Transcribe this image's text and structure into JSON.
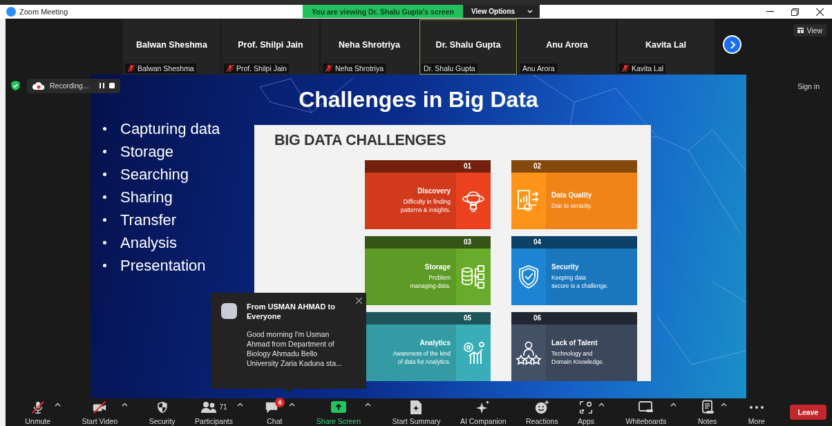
{
  "window": {
    "title": "Zoom Meeting"
  },
  "share_banner": {
    "text": "You are viewing Dr. Shalu Gupta's screen",
    "button": "View Options"
  },
  "participants": [
    {
      "name": "Balwan Sheshma",
      "label": "Balwan Sheshma",
      "muted": true,
      "selected": false
    },
    {
      "name": "Prof. Shilpi Jain",
      "label": "Prof. Shilpi Jain",
      "muted": true,
      "selected": false
    },
    {
      "name": "Neha Shrotriya",
      "label": "Neha Shrotriya",
      "muted": true,
      "selected": false
    },
    {
      "name": "Dr. Shalu Gupta",
      "label": "Dr. Shalu Gupta",
      "muted": false,
      "selected": true
    },
    {
      "name": "Anu Arora",
      "label": "Anu Arora",
      "muted": false,
      "selected": false
    },
    {
      "name": "Kavita Lal",
      "label": "Kavita Lal",
      "muted": true,
      "selected": false
    }
  ],
  "view_button": "View",
  "recording": {
    "label": "Recording..."
  },
  "sign_in": "Sign in",
  "slide": {
    "title": "Challenges in Big Data",
    "bullets": [
      "Capturing data",
      "Storage",
      "Searching",
      "Sharing",
      "Transfer",
      "Analysis",
      "Presentation"
    ],
    "panel": {
      "title": "BIG DATA CHALLENGES",
      "cards": [
        {
          "number": "01",
          "title": "Discovery",
          "text": "Difficulty in finding\npatterns & insights.",
          "color": "#d23a1c"
        },
        {
          "number": "02",
          "title": "Data Quality",
          "text": "Due to veracity.",
          "color": "#f08418"
        },
        {
          "number": "03",
          "title": "Storage",
          "text": "Problem\nmanaging data.",
          "color": "#5e9a26"
        },
        {
          "number": "04",
          "title": "Security",
          "text": "Keeping data\nsecure is a challenge.",
          "color": "#1a76bd"
        },
        {
          "number": "05",
          "title": "Analytics",
          "text": "Awareness of the kind\nof data for Analytics.",
          "color": "#349ba4"
        },
        {
          "number": "06",
          "title": "Lack of Talent",
          "text": "Technology and\nDomain Knowledge.",
          "color": "#3c475b"
        }
      ]
    }
  },
  "chat_popup": {
    "sender": "From USMAN AHMAD to Everyone",
    "message": "Good morning I'm Usman\nAhmad from Department of\nBiology Ahmadu Bello\nUniversity Zaria Kaduna sta..."
  },
  "toolbar": [
    {
      "label": "Unmute",
      "kind": "mic",
      "off": true,
      "caret": true
    },
    {
      "label": "Start Video",
      "kind": "video",
      "off": true,
      "caret": true
    },
    {
      "label": "Security",
      "kind": "security"
    },
    {
      "label": "Participants",
      "kind": "participants",
      "count": "71",
      "caret": true
    },
    {
      "label": "Chat",
      "kind": "chat",
      "badge": "6",
      "caret": true
    },
    {
      "label": "Share Screen",
      "kind": "share",
      "caret": true
    },
    {
      "label": "Start Summary",
      "kind": "summary"
    },
    {
      "label": "AI Companion",
      "kind": "ai"
    },
    {
      "label": "Reactions",
      "kind": "reactions"
    },
    {
      "label": "Apps",
      "kind": "apps",
      "caret": true
    },
    {
      "label": "Whiteboards",
      "kind": "whiteboards",
      "caret": true
    },
    {
      "label": "Notes",
      "kind": "notes",
      "caret": true
    },
    {
      "label": "More",
      "kind": "more"
    }
  ],
  "leave_button": "Leave"
}
